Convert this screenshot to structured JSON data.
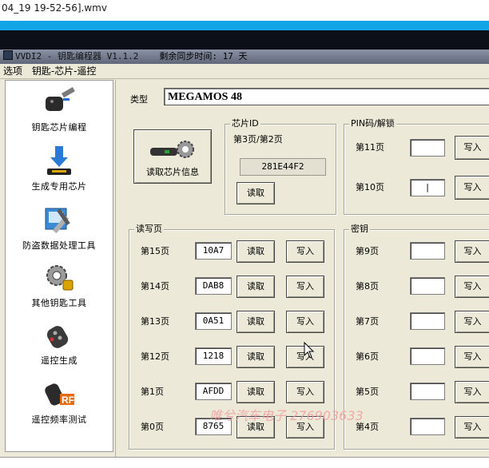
{
  "video_title": "04_19 19-52-56].wmv",
  "app": {
    "title": "VVDI2 - 钥匙编程器 V1.1.2",
    "sync_label": "剩余同步时间: 17 天"
  },
  "menu": [
    "选项",
    "钥匙-芯片-遥控"
  ],
  "sidebar": [
    {
      "label": "钥匙芯片编程",
      "icon": "key-chip-icon"
    },
    {
      "label": "生成专用芯片",
      "icon": "download-chip-icon"
    },
    {
      "label": "防盗数据处理工具",
      "icon": "tools-icon"
    },
    {
      "label": "其他钥匙工具",
      "icon": "gear-lock-icon"
    },
    {
      "label": "遥控生成",
      "icon": "remote-icon"
    },
    {
      "label": "遥控频率测试",
      "icon": "rf-icon"
    }
  ],
  "type": {
    "label": "类型",
    "value": "MEGAMOS 48"
  },
  "read_chip": {
    "label": "读取芯片信息"
  },
  "chip_id": {
    "title": "芯片ID",
    "page_label": "第3页/第2页",
    "value": "281E44F2",
    "read_button": "读取"
  },
  "pin": {
    "title": "PIN码/解锁",
    "rows": [
      {
        "label": "第11页",
        "value": "",
        "write_button": "写入"
      },
      {
        "label": "第10页",
        "value": "|",
        "write_button": "写入"
      }
    ]
  },
  "rw": {
    "title": "读写页",
    "rows": [
      {
        "label": "第15页",
        "value": "10A7",
        "read_button": "读取",
        "write_button": "写入"
      },
      {
        "label": "第14页",
        "value": "DAB8",
        "read_button": "读取",
        "write_button": "写入"
      },
      {
        "label": "第13页",
        "value": "0A51",
        "read_button": "读取",
        "write_button": "写入"
      },
      {
        "label": "第12页",
        "value": "1218",
        "read_button": "读取",
        "write_button": "写入"
      },
      {
        "label": "第1页",
        "value": "AFDD",
        "read_button": "读取",
        "write_button": "写入"
      },
      {
        "label": "第0页",
        "value": "8765",
        "read_button": "读取",
        "write_button": "写入"
      }
    ]
  },
  "keys": {
    "title": "密钥",
    "rows": [
      {
        "label": "第9页",
        "value": "",
        "write_button": "写入"
      },
      {
        "label": "第8页",
        "value": "",
        "write_button": "写入"
      },
      {
        "label": "第7页",
        "value": "",
        "write_button": "写入"
      },
      {
        "label": "第6页",
        "value": "",
        "write_button": "写入"
      },
      {
        "label": "第5页",
        "value": "",
        "write_button": "写入"
      },
      {
        "label": "第4页",
        "value": "",
        "write_button": "写入"
      }
    ]
  },
  "watermark": "唯兮汽车电子 276903633"
}
